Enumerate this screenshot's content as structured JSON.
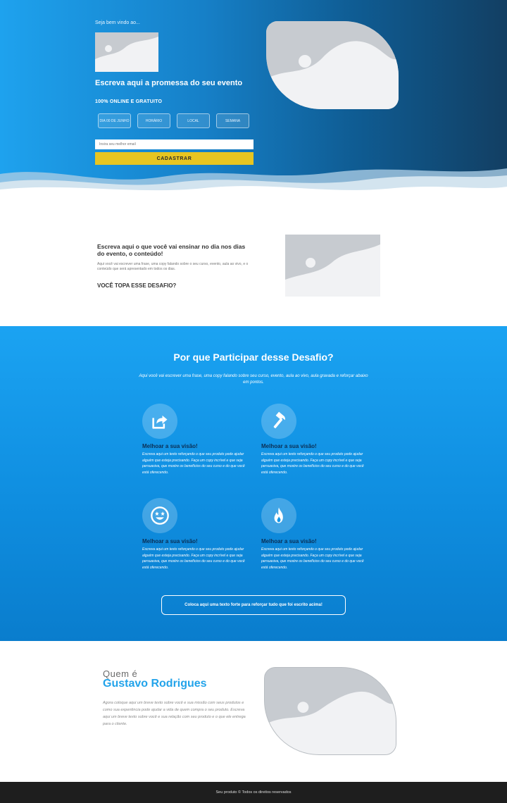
{
  "hero": {
    "welcome": "Seja bem vindo ao...",
    "promise": "Escreva aqui a promessa do seu evento",
    "tagline": "100% ONLINE E GRATUITO",
    "dates": [
      {
        "label": "DIA 00 DE JUNHO"
      },
      {
        "label": "HORÁRIO"
      },
      {
        "label": "LOCAL"
      },
      {
        "label": "SEMANA"
      }
    ],
    "email_placeholder": "Insira seu melhor email",
    "cta_label": "CADASTRAR"
  },
  "content": {
    "title": "Escreva aqui o que você vai ensinar no dia nos dias do evento, o conteúdo!",
    "description": "Aqui você vai escrever uma frase, uma copy falando sobre o seu curso, evento, aula ao vivo, e o conteúdo que será apresentado em todos os dias.",
    "challenge": "VOCÊ TOPA ESSE DESAFIO?"
  },
  "why": {
    "title": "Por que Participar desse Desafio?",
    "subtitle": "Aqui você vai escrever uma frase, uma copy falando sobre seu curso, evento, aula ao vivo, aula gravada e reforçar abaixo em pontos.",
    "features": [
      {
        "icon": "share-icon",
        "title": "Melhoar a sua visão!",
        "text": "Escreva aqui um texto reforçando o que seu produto pode ajudar alguém que esteja precisando. Faça um copy incrível e que seja persuasiva, que mostre os benefícios do seu curso e do que você está oferecendo."
      },
      {
        "icon": "hammer-icon",
        "title": "Melhoar a sua visão!",
        "text": "Escreva aqui um texto reforçando o que seu produto pode ajudar alguém que esteja precisando. Faça um copy incrível e que seja persuasiva, que mostre os benefícios do seu curso e do que você está oferecendo."
      },
      {
        "icon": "star-eyes-emoji-icon",
        "title": "Melhoar a sua visão!",
        "text": "Escreva aqui um texto reforçando o que seu produto pode ajudar alguém que esteja precisando. Faça um copy incrível e que seja persuasiva, que mostre os benefícios do seu curso e do que você está oferecendo."
      },
      {
        "icon": "fire-icon",
        "title": "Melhoar a sua visão!",
        "text": "Escreva aqui um texto reforçando o que seu produto pode ajudar alguém que esteja precisando. Faça um copy incrível e que seja persuasiva, que mostre os benefícios do seu curso e do que você está oferecendo."
      }
    ],
    "cta_label": "Coloca aqui uma texto forte para reforçar tudo que foi escrito acima!"
  },
  "about": {
    "pre": "Quem é",
    "name": "Gustavo Rodrigues",
    "text": "Agora coloque aqui um breve texto sobre você e sua missão com seus produtos e como sua experiência pode ajudar a vida de quem compra o seu produto. Escreva aqui um breve texto sobre você e sua relação com seu produto e o que ele entrega para o cliente."
  },
  "footer": {
    "text": "Seu produto © Todos os direitos reservados"
  },
  "colors": {
    "accent_blue": "#22a3ea",
    "cta_yellow": "#e7c521",
    "placeholder_gray": "#c7cbd0",
    "footer_dark": "#1e1e1e"
  }
}
